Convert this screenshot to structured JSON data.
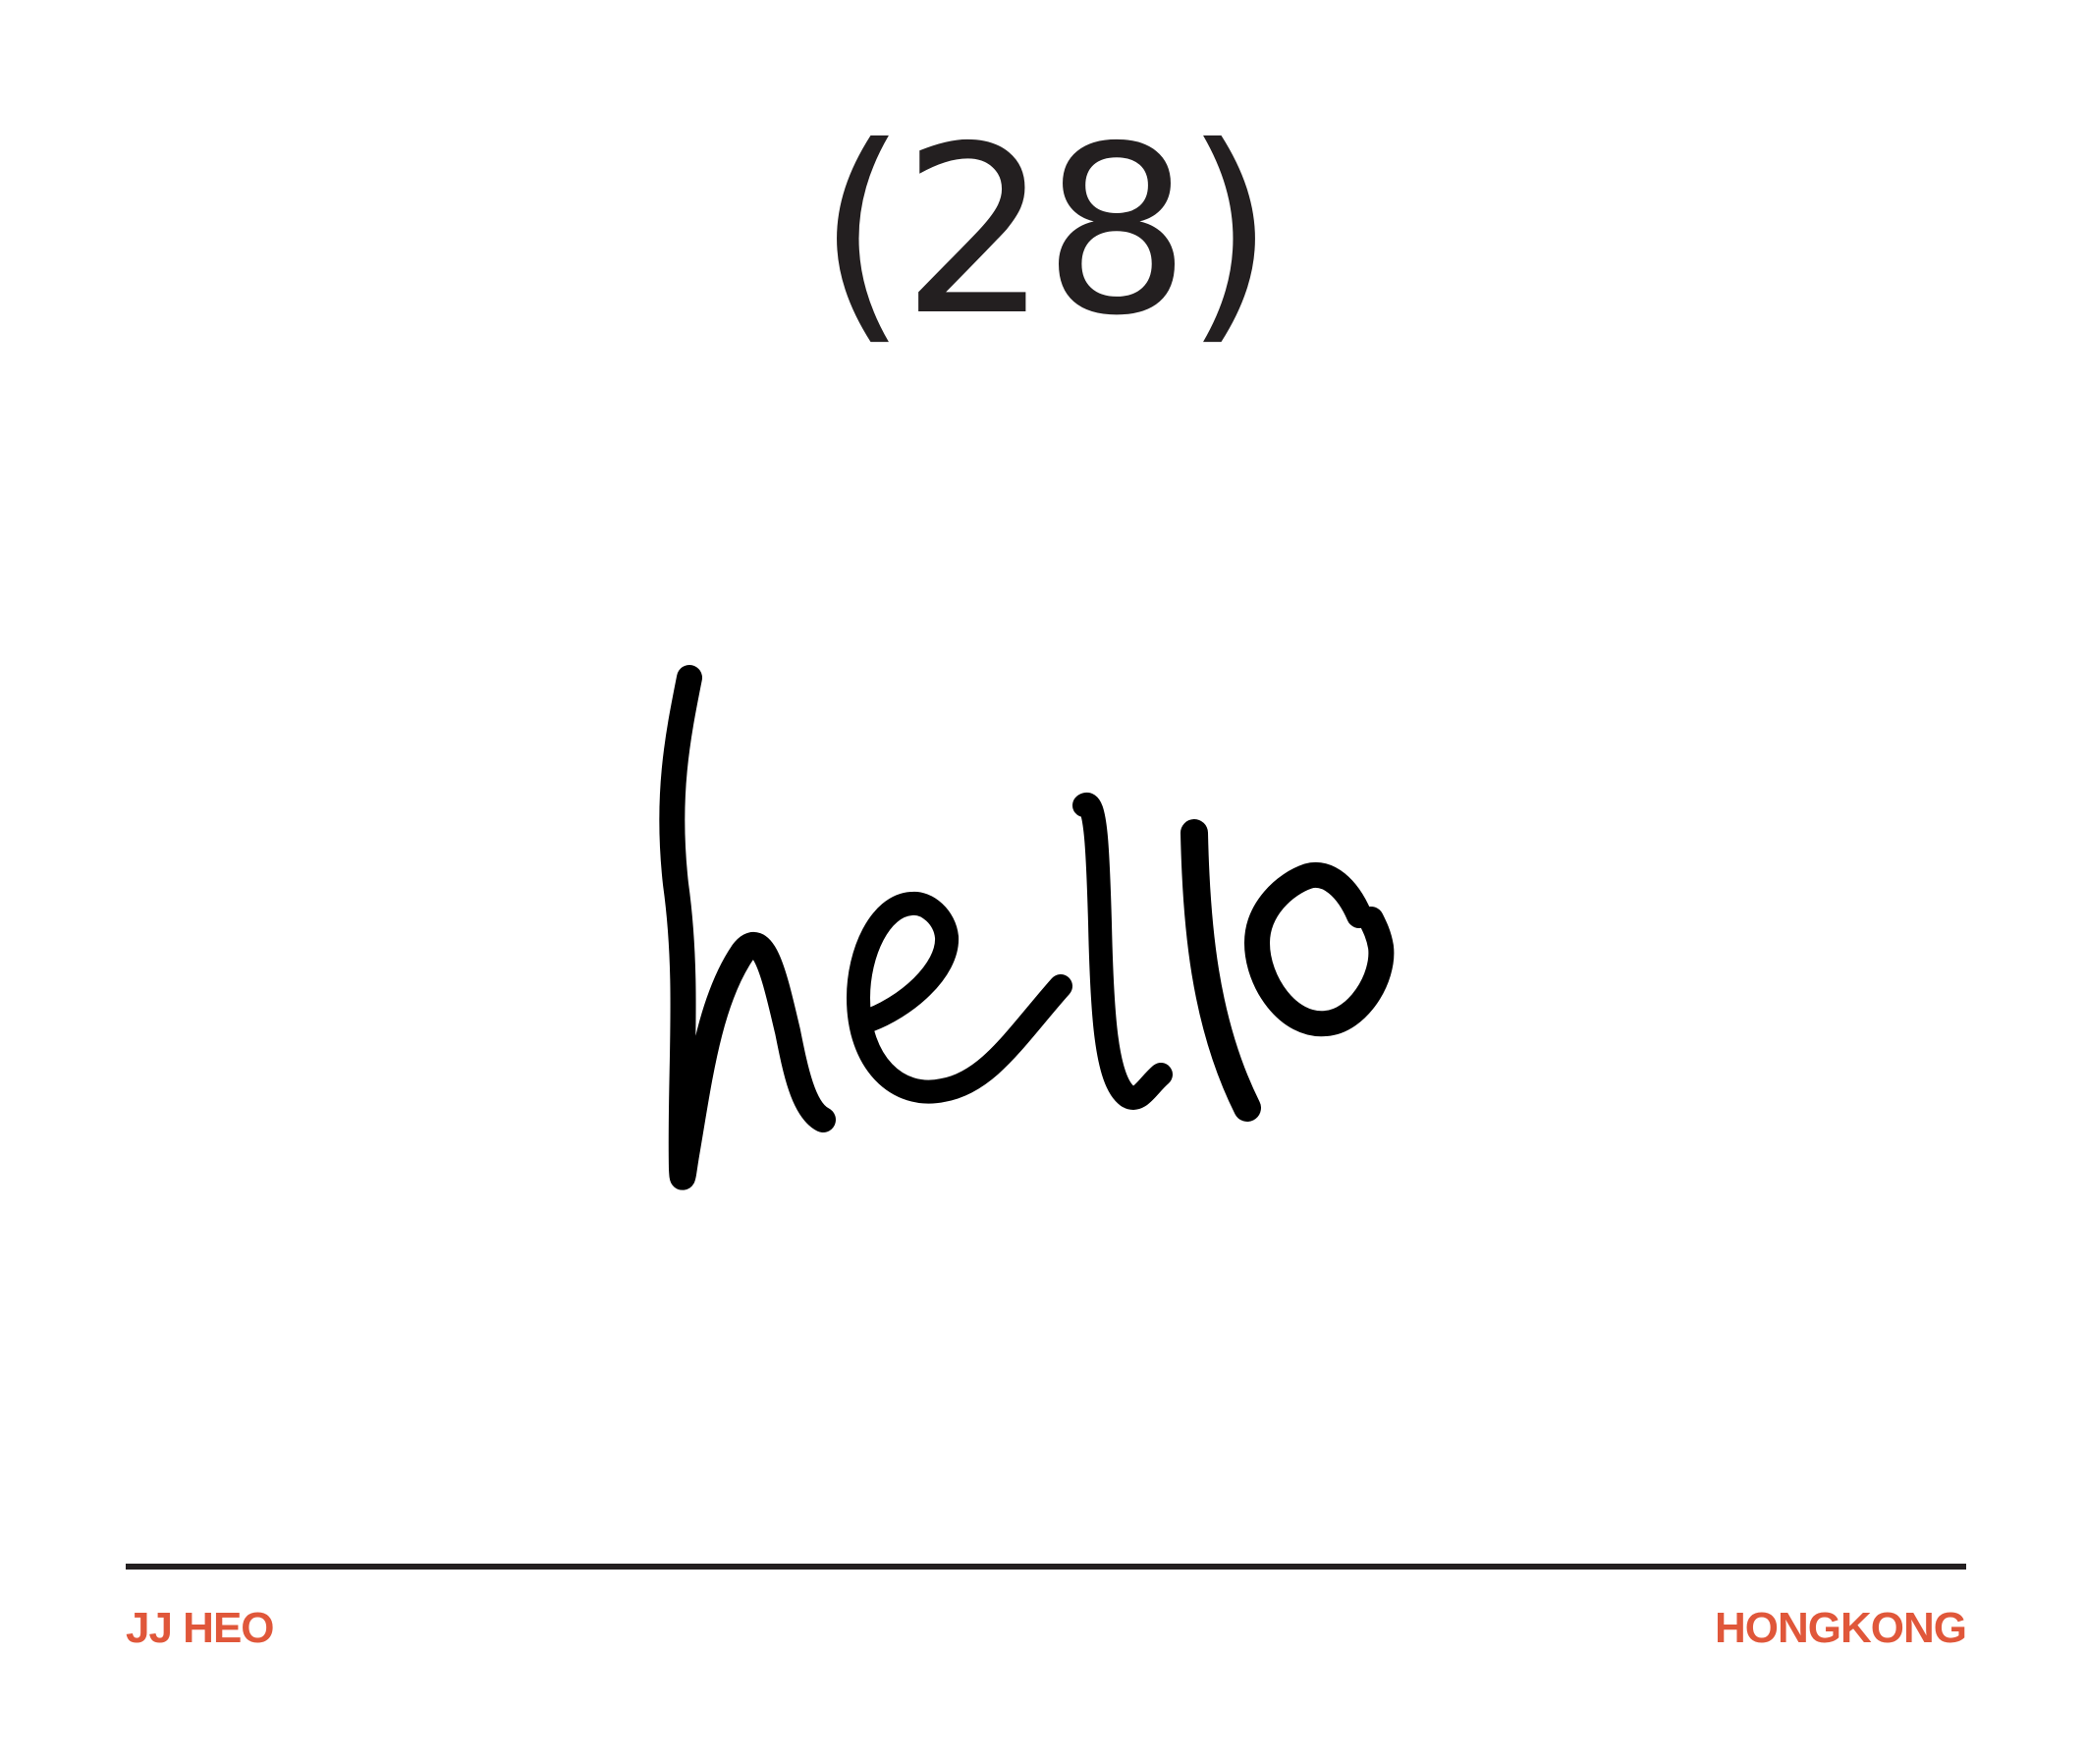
{
  "card": {
    "number": "(28)",
    "word": "hello",
    "author": "JJ HEO",
    "location": "HONGKONG"
  },
  "colors": {
    "background": "#ffffff",
    "ink": "#231f20",
    "handwriting": "#000000",
    "accent": "#e0573a"
  }
}
